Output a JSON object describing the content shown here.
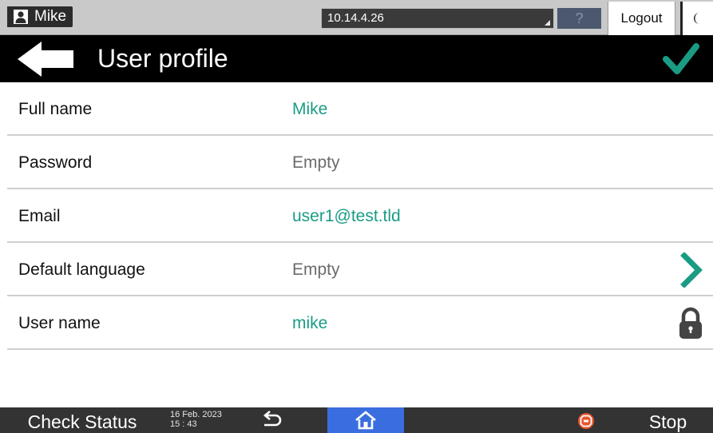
{
  "statusbar": {
    "user_icon": "user-icon",
    "user_name": "Mike",
    "address": "10.14.4.26",
    "help_label": "?",
    "logout_label": "Logout",
    "night_icon": "moon-icon"
  },
  "titlebar": {
    "back_icon": "arrow-left-icon",
    "title": "User profile",
    "confirm_icon": "checkmark-icon",
    "accent_color": "#1a9c84"
  },
  "fields": [
    {
      "label": "Full name",
      "value": "Mike",
      "state": "set"
    },
    {
      "label": "Password",
      "value": "Empty",
      "state": "empty"
    },
    {
      "label": "Email",
      "value": "user1@test.tld",
      "state": "set"
    },
    {
      "label": "Default language",
      "value": "Empty",
      "state": "empty",
      "trailing_icon": "chevron-right-icon"
    },
    {
      "label": "User name",
      "value": "mike",
      "state": "set",
      "trailing_icon": "lock-icon"
    }
  ],
  "bottombar": {
    "check_status_label": "Check Status",
    "date": "16 Feb. 2023",
    "time": "15 : 43",
    "undo_icon": "undo-arrow-icon",
    "home_icon": "home-icon",
    "stop_icon": "stop-icon",
    "stop_label": "Stop",
    "home_color": "#3a6ee0",
    "stop_color": "#e8552e"
  }
}
